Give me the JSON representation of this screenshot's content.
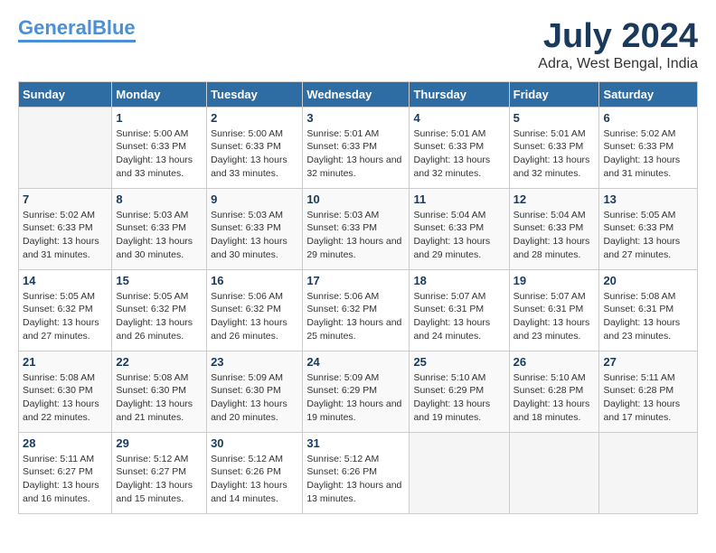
{
  "header": {
    "logo_general": "General",
    "logo_blue": "Blue",
    "month_year": "July 2024",
    "location": "Adra, West Bengal, India"
  },
  "days_of_week": [
    "Sunday",
    "Monday",
    "Tuesday",
    "Wednesday",
    "Thursday",
    "Friday",
    "Saturday"
  ],
  "weeks": [
    [
      {
        "day": "",
        "sunrise": "",
        "sunset": "",
        "daylight": ""
      },
      {
        "day": "1",
        "sunrise": "Sunrise: 5:00 AM",
        "sunset": "Sunset: 6:33 PM",
        "daylight": "Daylight: 13 hours and 33 minutes."
      },
      {
        "day": "2",
        "sunrise": "Sunrise: 5:00 AM",
        "sunset": "Sunset: 6:33 PM",
        "daylight": "Daylight: 13 hours and 33 minutes."
      },
      {
        "day": "3",
        "sunrise": "Sunrise: 5:01 AM",
        "sunset": "Sunset: 6:33 PM",
        "daylight": "Daylight: 13 hours and 32 minutes."
      },
      {
        "day": "4",
        "sunrise": "Sunrise: 5:01 AM",
        "sunset": "Sunset: 6:33 PM",
        "daylight": "Daylight: 13 hours and 32 minutes."
      },
      {
        "day": "5",
        "sunrise": "Sunrise: 5:01 AM",
        "sunset": "Sunset: 6:33 PM",
        "daylight": "Daylight: 13 hours and 32 minutes."
      },
      {
        "day": "6",
        "sunrise": "Sunrise: 5:02 AM",
        "sunset": "Sunset: 6:33 PM",
        "daylight": "Daylight: 13 hours and 31 minutes."
      }
    ],
    [
      {
        "day": "7",
        "sunrise": "Sunrise: 5:02 AM",
        "sunset": "Sunset: 6:33 PM",
        "daylight": "Daylight: 13 hours and 31 minutes."
      },
      {
        "day": "8",
        "sunrise": "Sunrise: 5:03 AM",
        "sunset": "Sunset: 6:33 PM",
        "daylight": "Daylight: 13 hours and 30 minutes."
      },
      {
        "day": "9",
        "sunrise": "Sunrise: 5:03 AM",
        "sunset": "Sunset: 6:33 PM",
        "daylight": "Daylight: 13 hours and 30 minutes."
      },
      {
        "day": "10",
        "sunrise": "Sunrise: 5:03 AM",
        "sunset": "Sunset: 6:33 PM",
        "daylight": "Daylight: 13 hours and 29 minutes."
      },
      {
        "day": "11",
        "sunrise": "Sunrise: 5:04 AM",
        "sunset": "Sunset: 6:33 PM",
        "daylight": "Daylight: 13 hours and 29 minutes."
      },
      {
        "day": "12",
        "sunrise": "Sunrise: 5:04 AM",
        "sunset": "Sunset: 6:33 PM",
        "daylight": "Daylight: 13 hours and 28 minutes."
      },
      {
        "day": "13",
        "sunrise": "Sunrise: 5:05 AM",
        "sunset": "Sunset: 6:33 PM",
        "daylight": "Daylight: 13 hours and 27 minutes."
      }
    ],
    [
      {
        "day": "14",
        "sunrise": "Sunrise: 5:05 AM",
        "sunset": "Sunset: 6:32 PM",
        "daylight": "Daylight: 13 hours and 27 minutes."
      },
      {
        "day": "15",
        "sunrise": "Sunrise: 5:05 AM",
        "sunset": "Sunset: 6:32 PM",
        "daylight": "Daylight: 13 hours and 26 minutes."
      },
      {
        "day": "16",
        "sunrise": "Sunrise: 5:06 AM",
        "sunset": "Sunset: 6:32 PM",
        "daylight": "Daylight: 13 hours and 26 minutes."
      },
      {
        "day": "17",
        "sunrise": "Sunrise: 5:06 AM",
        "sunset": "Sunset: 6:32 PM",
        "daylight": "Daylight: 13 hours and 25 minutes."
      },
      {
        "day": "18",
        "sunrise": "Sunrise: 5:07 AM",
        "sunset": "Sunset: 6:31 PM",
        "daylight": "Daylight: 13 hours and 24 minutes."
      },
      {
        "day": "19",
        "sunrise": "Sunrise: 5:07 AM",
        "sunset": "Sunset: 6:31 PM",
        "daylight": "Daylight: 13 hours and 23 minutes."
      },
      {
        "day": "20",
        "sunrise": "Sunrise: 5:08 AM",
        "sunset": "Sunset: 6:31 PM",
        "daylight": "Daylight: 13 hours and 23 minutes."
      }
    ],
    [
      {
        "day": "21",
        "sunrise": "Sunrise: 5:08 AM",
        "sunset": "Sunset: 6:30 PM",
        "daylight": "Daylight: 13 hours and 22 minutes."
      },
      {
        "day": "22",
        "sunrise": "Sunrise: 5:08 AM",
        "sunset": "Sunset: 6:30 PM",
        "daylight": "Daylight: 13 hours and 21 minutes."
      },
      {
        "day": "23",
        "sunrise": "Sunrise: 5:09 AM",
        "sunset": "Sunset: 6:30 PM",
        "daylight": "Daylight: 13 hours and 20 minutes."
      },
      {
        "day": "24",
        "sunrise": "Sunrise: 5:09 AM",
        "sunset": "Sunset: 6:29 PM",
        "daylight": "Daylight: 13 hours and 19 minutes."
      },
      {
        "day": "25",
        "sunrise": "Sunrise: 5:10 AM",
        "sunset": "Sunset: 6:29 PM",
        "daylight": "Daylight: 13 hours and 19 minutes."
      },
      {
        "day": "26",
        "sunrise": "Sunrise: 5:10 AM",
        "sunset": "Sunset: 6:28 PM",
        "daylight": "Daylight: 13 hours and 18 minutes."
      },
      {
        "day": "27",
        "sunrise": "Sunrise: 5:11 AM",
        "sunset": "Sunset: 6:28 PM",
        "daylight": "Daylight: 13 hours and 17 minutes."
      }
    ],
    [
      {
        "day": "28",
        "sunrise": "Sunrise: 5:11 AM",
        "sunset": "Sunset: 6:27 PM",
        "daylight": "Daylight: 13 hours and 16 minutes."
      },
      {
        "day": "29",
        "sunrise": "Sunrise: 5:12 AM",
        "sunset": "Sunset: 6:27 PM",
        "daylight": "Daylight: 13 hours and 15 minutes."
      },
      {
        "day": "30",
        "sunrise": "Sunrise: 5:12 AM",
        "sunset": "Sunset: 6:26 PM",
        "daylight": "Daylight: 13 hours and 14 minutes."
      },
      {
        "day": "31",
        "sunrise": "Sunrise: 5:12 AM",
        "sunset": "Sunset: 6:26 PM",
        "daylight": "Daylight: 13 hours and 13 minutes."
      },
      {
        "day": "",
        "sunrise": "",
        "sunset": "",
        "daylight": ""
      },
      {
        "day": "",
        "sunrise": "",
        "sunset": "",
        "daylight": ""
      },
      {
        "day": "",
        "sunrise": "",
        "sunset": "",
        "daylight": ""
      }
    ]
  ]
}
